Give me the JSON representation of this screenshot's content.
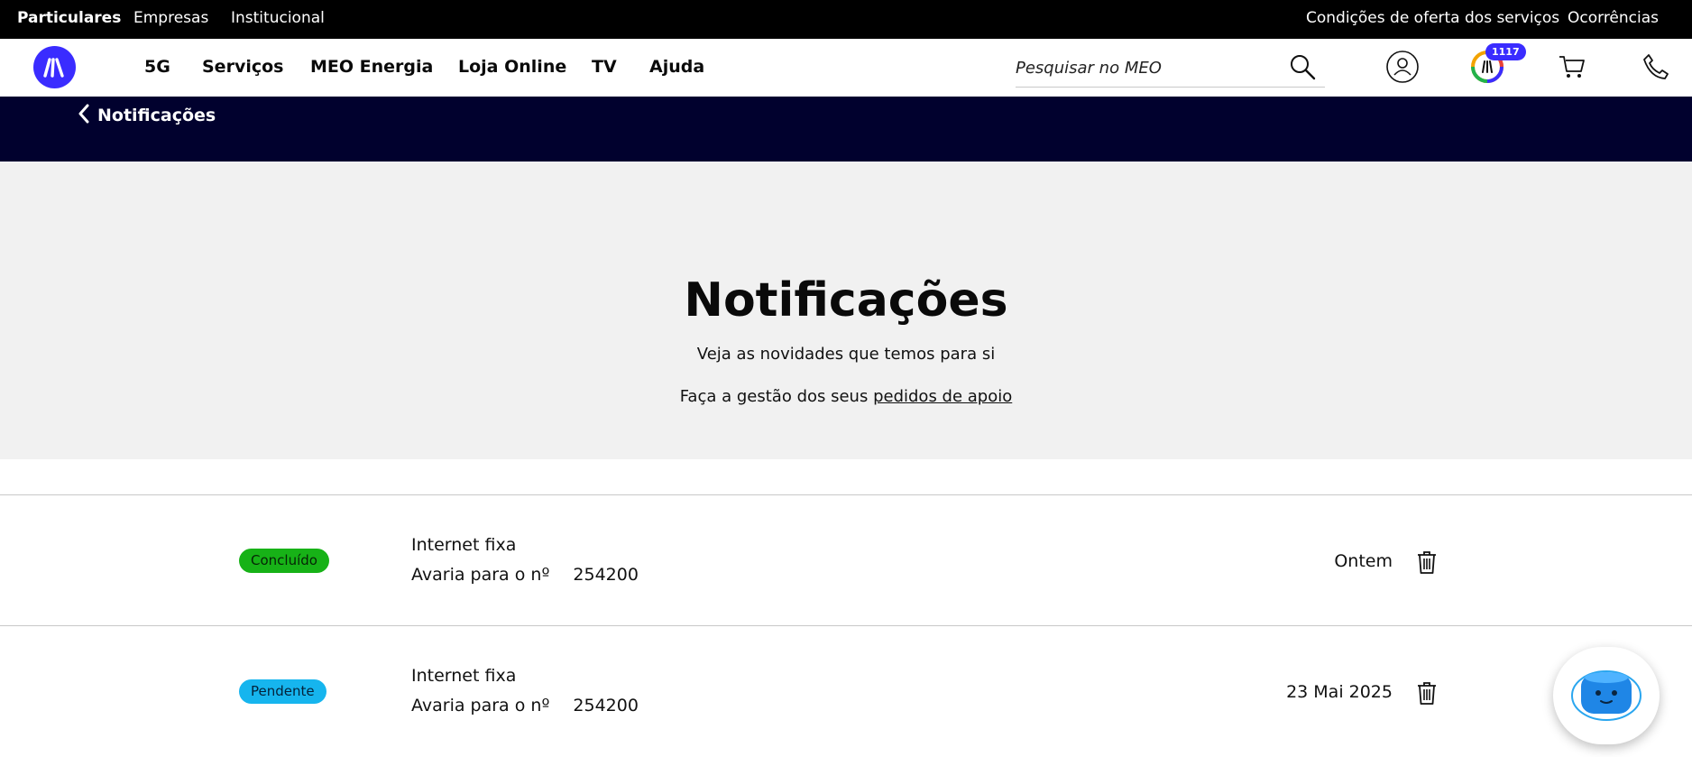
{
  "topbar": {
    "left_links": [
      "Particulares",
      "Empresas",
      "Institucional"
    ],
    "right_links": [
      "Condições de oferta dos serviços",
      "Ocorrências"
    ]
  },
  "nav": {
    "items": [
      "5G",
      "Serviços",
      "MEO Energia",
      "Loja Online",
      "TV",
      "Ajuda"
    ],
    "search_placeholder": "Pesquisar no MEO",
    "points_badge": "1117"
  },
  "band": {
    "back_label": "Notificações"
  },
  "hero": {
    "title": "Notificações",
    "subtitle": "Veja as novidades que temos para si",
    "support_prefix": "Faça a gestão dos seus ",
    "support_link": "pedidos de apoio"
  },
  "notifications": [
    {
      "status": "Concluído",
      "status_color": "#17b217",
      "title": "Internet fixa",
      "desc": "Avaria para o nº",
      "number": "254200",
      "date": "Ontem"
    },
    {
      "status": "Pendente",
      "status_color": "#16b5ee",
      "title": "Internet fixa",
      "desc": "Avaria para o nº",
      "number": "254200",
      "date": "23 Mai 2025"
    }
  ],
  "colors": {
    "brand": "#3a2cff",
    "band": "#01012e",
    "hero_bg": "#f1f1f1"
  },
  "icons": [
    "meo-logo-icon",
    "search-icon",
    "user-icon",
    "meo-points-icon",
    "cart-icon",
    "phone-icon",
    "chevron-left-icon",
    "trash-icon",
    "chat-assistant-icon"
  ]
}
